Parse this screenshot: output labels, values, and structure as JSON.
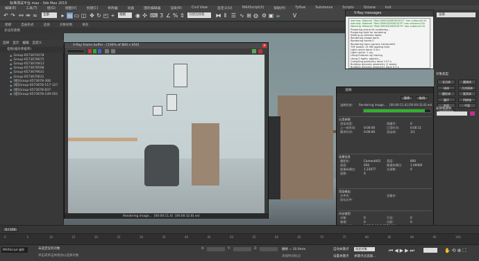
{
  "app": {
    "title": "标准测试平台.max - 3ds Max 2015"
  },
  "menu": [
    "编辑(E)",
    "工具(T)",
    "组(G)",
    "视图(V)",
    "创建(C)",
    "修改器",
    "动画",
    "图形编辑器",
    "渲染(R)",
    "Civil View",
    "自定义(U)",
    "MAXScript(X)",
    "帮助(H)",
    "Tyflow",
    "Substance",
    "Scripts",
    "Octane",
    "kcd"
  ],
  "toolbar": {
    "selection_filter": "全部",
    "view_dropdown": "视图",
    "selection_set": "创建选择集"
  },
  "ribbon": {
    "tabs": [
      "建模",
      "自由形式",
      "选择",
      "对象绘制",
      "填充"
    ],
    "sub": "多边形建模"
  },
  "scene_explorer": {
    "tabs": [
      "选择",
      "显示",
      "编辑",
      "自定义"
    ],
    "header": "名称(按升序排序)",
    "items": [
      "Group-6573674578",
      "Group-6573678675",
      "Group-6573674913",
      "Group-6573678508",
      "Group-6573679631",
      "Group-6573670631",
      "[组]Group-6573678-306",
      "[组]Group-6573678-117-127",
      "[组]Group-6573678-837",
      "[组]Group-6573678-149-561"
    ]
  },
  "vfb": {
    "title": "V-Ray frame buffer - [100% of 800 x 650]",
    "status": "Rendering image...",
    "time": "[00:00:11.4]",
    "extra": "[00:00:32.8] est"
  },
  "vray_messages": {
    "title": "V-Ray messages",
    "lines": [
      "warning: Material \"Mat.GMX93/NRY4E9537\" has unbound UV",
      "warning: Material \"Mat.GMX93/9X0E3579\" has unbound UV",
      "Warning: Material \"Mat.GMX93/9X0E3579\" has unbound UV",
      "Preparing scene for rendering...",
      "Preparing light for rendering",
      "Setting up embree lights",
      "Rendering image done",
      "Rendering frame 0",
      "Rendering from camera Camera001",
      "THF bokeh: 21 MB loading time",
      "Light cache done: 0.6 s",
      "Light cache: 1 ray",
      "Using Embree ray tracing",
      "Using 0 lights, objects...",
      "Compiling geometry done 1.07 s",
      "Building dynamic geometry (1 tasks)",
      "Building dynamic geometry done 0.5 s",
      "Compiling scene complete 0.3 s",
      "Scene loaded",
      "Rendering image..."
    ]
  },
  "render_progress": {
    "title": "渲染",
    "buttons": [
      "暂停",
      "取消"
    ],
    "current_task_label": "当前任务:",
    "current_task": "Rendering image...",
    "current_time": "[00:00:11.4] [00:00:32.8] est",
    "progress": 0.92,
    "params_title": "公用参数",
    "params": [
      {
        "label": "渲染进度:",
        "value": ""
      },
      {
        "label": "帧编号:",
        "value": "0"
      },
      {
        "label": "上一帧时间:",
        "value": "0:00:00"
      },
      {
        "label": "已用时间:",
        "value": "0:00:11"
      },
      {
        "label": "剩余时间:",
        "value": "0:00:00"
      },
      {
        "label": "渲染帧:",
        "value": "1/1"
      }
    ],
    "scene_title": "场景信息",
    "scene": [
      {
        "label": "摄影机:",
        "value": "Camera001"
      },
      {
        "label": "宽度:",
        "value": "800"
      },
      {
        "label": "高度:",
        "value": "650"
      },
      {
        "label": "像素纵横比:",
        "value": "1.00000"
      },
      {
        "label": "图像纵横比:",
        "value": "1.23077"
      },
      {
        "label": "光源数:",
        "value": "0"
      },
      {
        "label": "面数:",
        "value": "0"
      }
    ],
    "output_title": "渲染输出",
    "output": [
      {
        "label": "文件名:",
        "value": ""
      },
      {
        "label": "设备名:",
        "value": ""
      },
      {
        "label": "保存文件:",
        "value": ""
      }
    ],
    "memory_title": "内存使用",
    "memory": [
      {
        "label": "对象:",
        "value": "0"
      },
      {
        "label": "可见:",
        "value": "0"
      },
      {
        "label": "物理:",
        "value": "0"
      },
      {
        "label": "分配:",
        "value": "0"
      },
      {
        "label": "内存使用:",
        "value": "P:2741.1M P:3271.1M"
      }
    ]
  },
  "right_panel": {
    "dropdown": "渲染",
    "object_type": "对象类型",
    "name_color": "名称和颜色",
    "buttons": [
      "长方体",
      "圆锥体",
      "球体",
      "几何球体",
      "圆柱体",
      "管状体",
      "圆环",
      "四棱锥",
      "茶壶",
      "平面",
      "加强型文本"
    ]
  },
  "timeline": {
    "frame": "0 / 100",
    "ticks": [
      "0",
      "5",
      "10",
      "15",
      "20",
      "25",
      "30",
      "35",
      "40",
      "45",
      "50",
      "55",
      "60",
      "65",
      "70",
      "75",
      "80",
      "85",
      "90",
      "95",
      "100"
    ]
  },
  "status_bar": {
    "maxscript": "MAXScript 迷你",
    "selected": "未选定任何对象",
    "hint": "单击或单击并拖动以选择对象",
    "x": "X:",
    "y": "Y:",
    "z": "Z:",
    "grid": "栅格 = 10.0mm",
    "add_key": "添加时间标记",
    "auto_key": "自动关键点",
    "set_key": "设置关键点",
    "key_filter": "关键点过滤器...",
    "selected_label": "选定对象"
  }
}
